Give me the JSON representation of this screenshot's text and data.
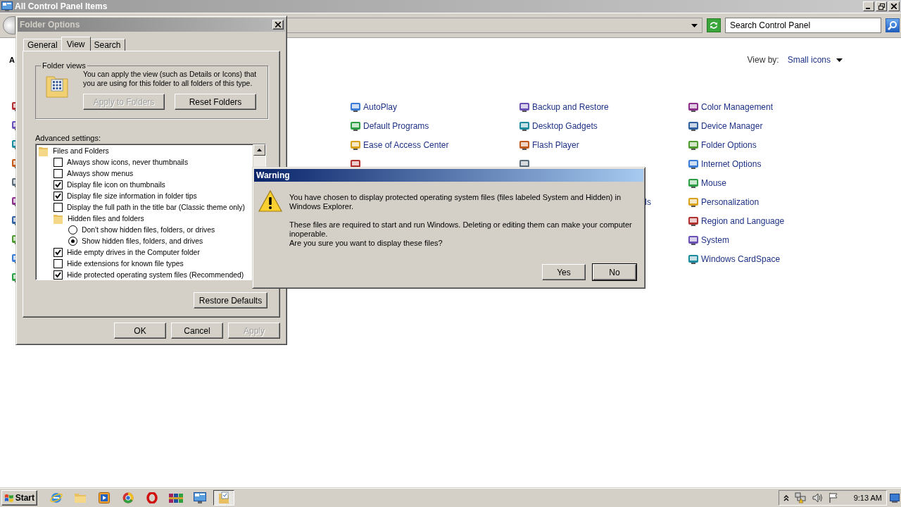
{
  "explorer": {
    "title": "All Control Panel Items",
    "search": {
      "placeholder": "Search Control Panel"
    },
    "view_by": {
      "label": "View by:",
      "value": "Small icons"
    },
    "heading": "A",
    "columns": [
      [
        {
          "kind": "link",
          "label": "AutoPlay"
        },
        {
          "kind": "link",
          "label": "Default Programs"
        },
        {
          "kind": "link",
          "label": "Ease of Access Center"
        },
        {
          "kind": "covered"
        }
      ],
      [
        {
          "kind": "link",
          "label": "Backup and Restore"
        },
        {
          "kind": "link",
          "label": "Desktop Gadgets"
        },
        {
          "kind": "link",
          "label": "Flash Player"
        },
        {
          "kind": "covered"
        },
        {
          "kind": "fragment",
          "label": "ls"
        }
      ],
      [
        {
          "kind": "link",
          "label": "Color Management"
        },
        {
          "kind": "link",
          "label": "Device Manager"
        },
        {
          "kind": "link",
          "label": "Folder Options"
        },
        {
          "kind": "link",
          "label": "Internet Options"
        },
        {
          "kind": "link",
          "label": "Mouse"
        },
        {
          "kind": "link",
          "label": "Personalization"
        },
        {
          "kind": "link",
          "label": "Region and Language"
        },
        {
          "kind": "link",
          "label": "System"
        },
        {
          "kind": "link",
          "label": "Windows CardSpace"
        }
      ]
    ]
  },
  "folder_options": {
    "title": "Folder Options",
    "tabs": [
      {
        "label": "General",
        "selected": false
      },
      {
        "label": "View",
        "selected": true
      },
      {
        "label": "Search",
        "selected": false
      }
    ],
    "folder_views": {
      "legend": "Folder views",
      "text": "You can apply the view (such as Details or Icons) that you are using for this folder to all folders of this type.",
      "buttons": [
        {
          "label": "Apply to Folders",
          "disabled": true
        },
        {
          "label": "Reset Folders",
          "disabled": false
        }
      ]
    },
    "advanced_label": "Advanced settings:",
    "settings": [
      {
        "kind": "folder",
        "label": "Files and Folders",
        "children": [
          {
            "kind": "checkbox",
            "label": "Always show icons, never thumbnails",
            "checked": false
          },
          {
            "kind": "checkbox",
            "label": "Always show menus",
            "checked": false
          },
          {
            "kind": "checkbox",
            "label": "Display file icon on thumbnails",
            "checked": true
          },
          {
            "kind": "checkbox",
            "label": "Display file size information in folder tips",
            "checked": true
          },
          {
            "kind": "checkbox",
            "label": "Display the full path in the title bar (Classic theme only)",
            "checked": false
          },
          {
            "kind": "folder",
            "label": "Hidden files and folders",
            "children": [
              {
                "kind": "radio",
                "label": "Don't show hidden files, folders, or drives",
                "selected": false
              },
              {
                "kind": "radio",
                "label": "Show hidden files, folders, and drives",
                "selected": true
              }
            ]
          },
          {
            "kind": "checkbox",
            "label": "Hide empty drives in the Computer folder",
            "checked": true
          },
          {
            "kind": "checkbox",
            "label": "Hide extensions for known file types",
            "checked": false
          },
          {
            "kind": "checkbox",
            "label": "Hide protected operating system files (Recommended)",
            "checked": true
          }
        ]
      }
    ],
    "restore_button": "Restore Defaults",
    "buttons": [
      {
        "label": "OK",
        "disabled": false
      },
      {
        "label": "Cancel",
        "disabled": false
      },
      {
        "label": "Apply",
        "disabled": true
      }
    ]
  },
  "warning": {
    "title": "Warning",
    "paragraphs": [
      [
        "You have chosen to display protected operating system files (files labeled System and Hidden) in Windows Explorer."
      ],
      [
        "These files are required to start and run Windows. Deleting or editing them can make your computer inoperable.",
        "Are you sure you want to display these files?"
      ]
    ],
    "buttons": [
      {
        "label": "Yes",
        "default": false
      },
      {
        "label": "No",
        "default": true
      }
    ]
  },
  "taskbar": {
    "start": "Start",
    "apps": [
      {
        "active": false
      },
      {
        "active": false
      },
      {
        "active": false
      },
      {
        "active": false
      },
      {
        "active": false
      },
      {
        "active": false
      },
      {
        "active": false
      },
      {
        "active": true
      }
    ],
    "clock": "9:13 AM"
  }
}
